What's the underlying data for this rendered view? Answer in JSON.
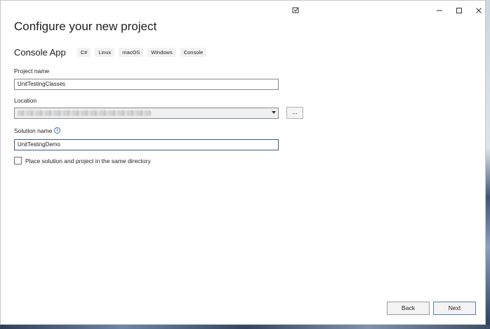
{
  "dialog": {
    "title": "Configure your new project"
  },
  "template": {
    "name": "Console App",
    "tags": [
      "C#",
      "Linux",
      "macOS",
      "Windows",
      "Console"
    ]
  },
  "fields": {
    "project_name": {
      "label": "Project name",
      "value": "UnitTestingClasses"
    },
    "location": {
      "label": "Location",
      "value": "",
      "browse_label": "..."
    },
    "solution_name": {
      "label": "Solution name",
      "value": "UnitTestingDemo"
    },
    "same_directory": {
      "label": "Place solution and project in the same directory",
      "checked": false
    }
  },
  "buttons": {
    "back": "Back",
    "next": "Next"
  },
  "titlebar_icons": [
    "feedback-icon",
    "minimize-icon",
    "maximize-icon",
    "close-icon"
  ]
}
